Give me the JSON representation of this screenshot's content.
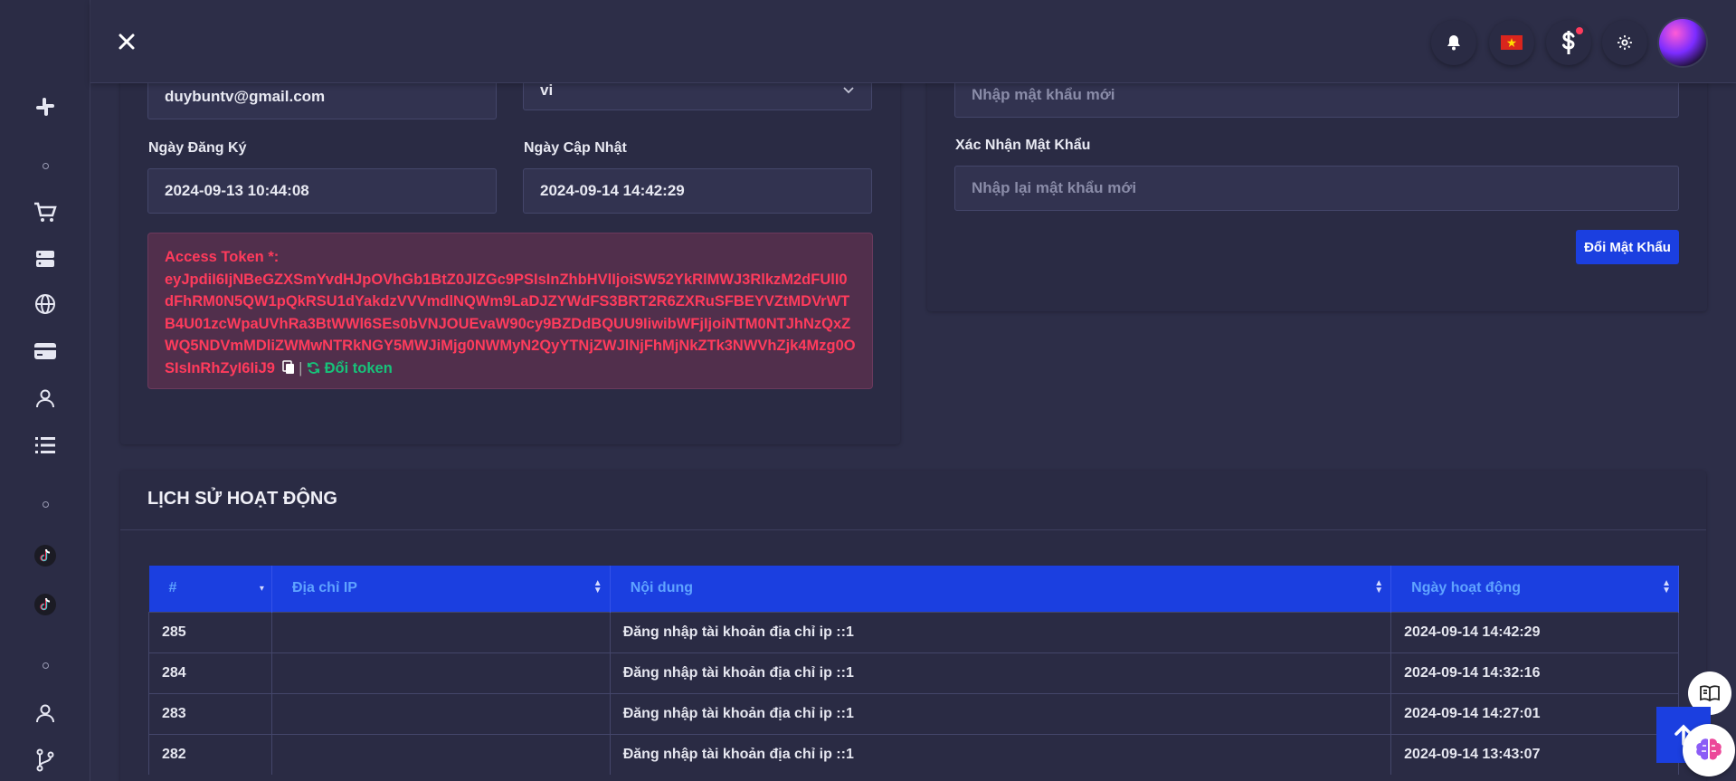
{
  "profile": {
    "email": "duybuntv@gmail.com",
    "language": "vi",
    "registered_label": "Ngày Đăng Ký",
    "registered_value": "2024-09-13 10:44:08",
    "updated_label": "Ngày Cập Nhật",
    "updated_value": "2024-09-14 14:42:29",
    "token_label": "Access Token *:",
    "token_value": "eyJpdiI6IjNBeGZXSmYvdHJpOVhGb1BtZ0JlZGc9PSIsInZhbHVlIjoiSW52YkRlMWJ3RlkzM2dFUlI0dFhRM0N5QW1pQkRSU1dYakdzVVVmdlNQWm9LaDJZYWdFS3BRT2R6ZXRuSFBEYVZtMDVrWTB4U01zcWpaUVhRa3BtWWl6SEs0bVNJOUEvaW90cy9BZDdBQUU9IiwibWFjIjoiNTM0NTJhNzQxZWQ5NDVmMDliZWMwNTRkNGY5MWJiMjg0NWMyN2QyYTNjZWJlNjFhMjNkZTk3NWVhZjk4Mzg0OSIsInRhZyI6IiJ9",
    "token_sep": "|",
    "token_refresh": "Đổi token"
  },
  "password": {
    "new_placeholder": "Nhập mật khẩu mới",
    "confirm_label": "Xác Nhận Mật Khẩu",
    "confirm_placeholder": "Nhập lại mật khẩu mới",
    "submit_label": "Đổi Mật Khẩu"
  },
  "history": {
    "title": "LỊCH SỬ HOẠT ĐỘNG",
    "columns": [
      "#",
      "Địa chỉ IP",
      "Nội dung",
      "Ngày hoạt động"
    ],
    "rows": [
      {
        "id": "285",
        "ip": "",
        "content": "Đăng nhập tài khoản địa chỉ ip ::1",
        "date": "2024-09-14 14:42:29"
      },
      {
        "id": "284",
        "ip": "",
        "content": "Đăng nhập tài khoản địa chỉ ip ::1",
        "date": "2024-09-14 14:32:16"
      },
      {
        "id": "283",
        "ip": "",
        "content": "Đăng nhập tài khoản địa chỉ ip ::1",
        "date": "2024-09-14 14:27:01"
      },
      {
        "id": "282",
        "ip": "",
        "content": "Đăng nhập tài khoản địa chỉ ip ::1",
        "date": "2024-09-14 13:43:07"
      }
    ]
  },
  "colors": {
    "primary": "#1b3fe0",
    "danger": "#ff3b5c",
    "success": "#17c37a",
    "background": "#2d2e48"
  },
  "icons": {
    "header": [
      "close-icon",
      "bell-icon",
      "vietnam-flag-icon",
      "dollar-icon",
      "gear-icon"
    ],
    "sidebar": [
      "slack-icon",
      "cart-icon",
      "server-icon",
      "globe-icon",
      "credit-card-icon",
      "user-icon",
      "list-icon",
      "tiktok-icon",
      "user-icon",
      "git-branch-icon"
    ]
  }
}
